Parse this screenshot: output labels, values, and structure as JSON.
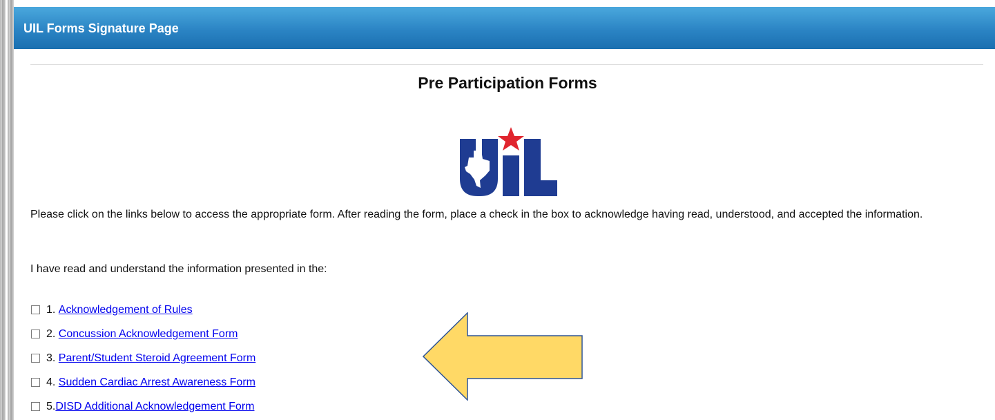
{
  "header": {
    "title": "UIL Forms Signature Page"
  },
  "page": {
    "title": "Pre Participation Forms",
    "logo_text": "UIL",
    "intro": "Please click on the links below to access the appropriate form. After reading the form, place a check in the box to acknowledge having read, understood, and accepted the information.",
    "lead": "I have read and understand the information presented in the:"
  },
  "forms": [
    {
      "number": "1. ",
      "link": "Acknowledgement of Rules",
      "checked": false
    },
    {
      "number": "2. ",
      "link": "Concussion Acknowledgement Form",
      "checked": false
    },
    {
      "number": "3. ",
      "link": "Parent/Student Steroid Agreement Form",
      "checked": false
    },
    {
      "number": "4. ",
      "link": "Sudden Cardiac Arrest Awareness Form",
      "checked": false
    },
    {
      "number": "5.",
      "link": "DISD Additional Acknowledgement Form",
      "checked": false
    }
  ],
  "colors": {
    "header_top": "#4aa8dd",
    "header_bottom": "#1a6fb0",
    "logo_blue": "#1f3c92",
    "logo_red": "#e0252e",
    "arrow_fill": "#ffd966",
    "arrow_stroke": "#2f5597",
    "link": "#0000ee"
  }
}
